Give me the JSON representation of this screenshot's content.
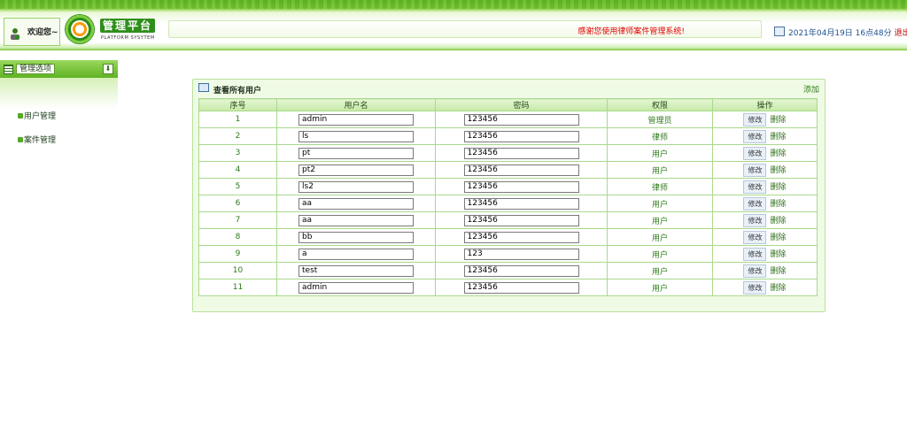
{
  "header": {
    "welcome": "欢迎您~",
    "logo_title": "管理平台",
    "logo_subtitle": "PLATFORM SYSYTEM",
    "notice": "感谢您使用律师案件管理系统!",
    "datetime": "2021年04月19日 16点48分",
    "logout": "退出"
  },
  "sidebar": {
    "title": "管理选项",
    "items": [
      {
        "label": "用户管理"
      },
      {
        "label": "案件管理"
      }
    ]
  },
  "panel": {
    "title": "查看所有用户",
    "add_label": "添加",
    "columns": [
      "序号",
      "用户名",
      "密码",
      "权限",
      "操作"
    ],
    "edit_label": "修改",
    "delete_label": "删除",
    "rows": [
      {
        "no": "1",
        "username": "admin",
        "password": "123456",
        "role": "管理员"
      },
      {
        "no": "2",
        "username": "ls",
        "password": "123456",
        "role": "律师"
      },
      {
        "no": "3",
        "username": "pt",
        "password": "123456",
        "role": "用户"
      },
      {
        "no": "4",
        "username": "pt2",
        "password": "123456",
        "role": "用户"
      },
      {
        "no": "5",
        "username": "ls2",
        "password": "123456",
        "role": "律师"
      },
      {
        "no": "6",
        "username": "aa",
        "password": "123456",
        "role": "用户"
      },
      {
        "no": "7",
        "username": "aa",
        "password": "123456",
        "role": "用户"
      },
      {
        "no": "8",
        "username": "bb",
        "password": "123456",
        "role": "用户"
      },
      {
        "no": "9",
        "username": "a",
        "password": "123",
        "role": "用户"
      },
      {
        "no": "10",
        "username": "test",
        "password": "123456",
        "role": "用户"
      },
      {
        "no": "11",
        "username": "admin",
        "password": "123456",
        "role": "用户"
      }
    ]
  },
  "colors": {
    "brand_green": "#2f8f1c",
    "notice_red": "#e00000",
    "border_green": "#a9d98c"
  }
}
